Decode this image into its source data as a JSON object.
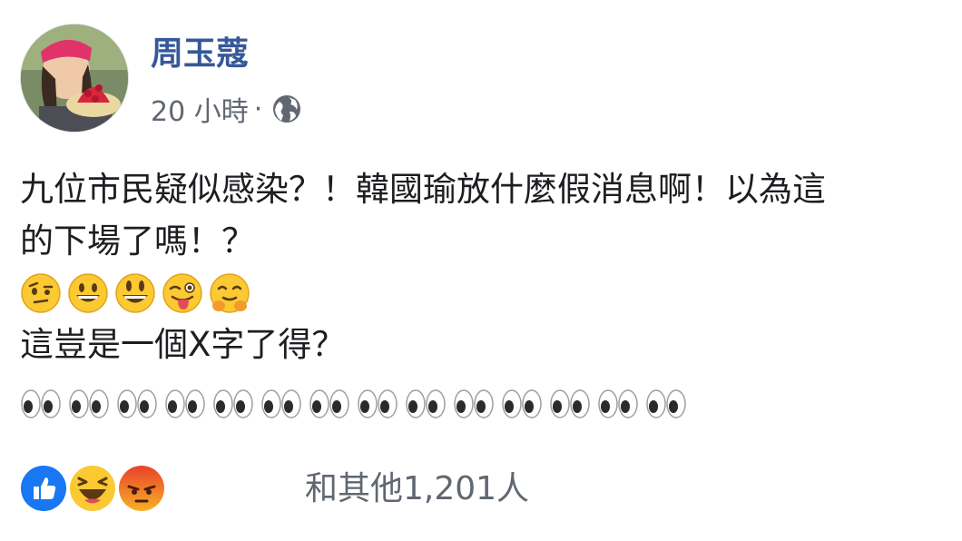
{
  "post": {
    "author": "周玉蔻",
    "time": "20 小時",
    "separator": "·",
    "privacy_icon": "globe-icon",
    "text_lines": [
      "九位市民疑似感染？！韓國瑜放什麼假消息啊！以為這",
      "的下場了嗎！？"
    ],
    "emoji_row": [
      "face-with-raised-eyebrow-emoji",
      "grinning-face-emoji",
      "smiley-face-emoji",
      "winking-tongue-face-emoji",
      "hugging-face-emoji"
    ],
    "line_after_emoji": "這豈是一個X字了得？",
    "eyes_count": 14
  },
  "reactions": {
    "icons": [
      "like-icon",
      "haha-icon",
      "angry-icon"
    ],
    "count_text": "和其他1,201人"
  },
  "colors": {
    "name": "#365899",
    "meta": "#606770",
    "text": "#1c1e21",
    "like": "#1877f2",
    "emoji_yellow": "#fbc932",
    "angry": "#f0651c"
  }
}
